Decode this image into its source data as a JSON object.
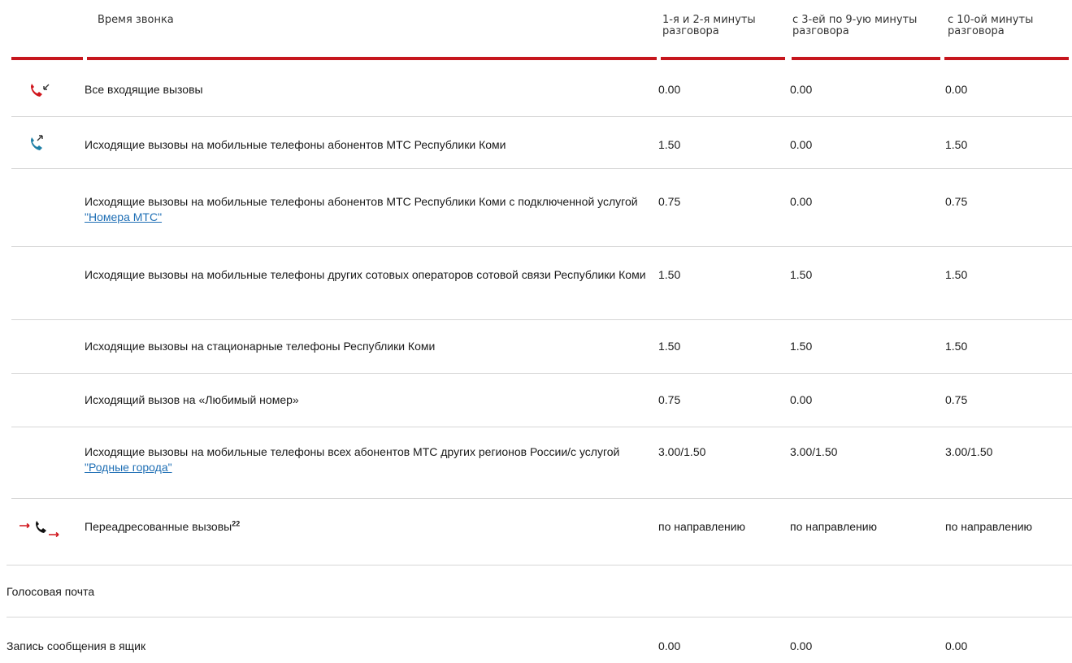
{
  "header": {
    "col_name": "Время звонка",
    "col_v1": "1-я и 2-я минуты разговора",
    "col_v2": "с 3-ей по 9-ую минуты разговора",
    "col_v3": "с 10-ой минуты разговора"
  },
  "rows": [
    {
      "icon": "incoming-call-icon",
      "label": "Все входящие вызовы",
      "v1": "0.00",
      "v2": "0.00",
      "v3": "0.00"
    },
    {
      "icon": "outgoing-call-icon",
      "label": "Исходящие вызовы на мобильные телефоны абонентов МТС Республики Коми",
      "v1": "1.50",
      "v2": "0.00",
      "v3": "1.50"
    },
    {
      "label_pre": "Исходящие вызовы на мобильные телефоны абонентов МТС Республики Коми с подключенной услугой ",
      "link": "\"Номера МТС\"",
      "v1": "0.75",
      "v2": "0.00",
      "v3": "0.75"
    },
    {
      "label": "Исходящие вызовы на мобильные телефоны других сотовых операторов сотовой связи Республики Коми",
      "v1": "1.50",
      "v2": "1.50",
      "v3": "1.50"
    },
    {
      "label": "Исходящие вызовы на стационарные телефоны Республики Коми",
      "v1": "1.50",
      "v2": "1.50",
      "v3": "1.50"
    },
    {
      "label": "Исходящий вызов на «Любимый номер»",
      "v1": "0.75",
      "v2": "0.00",
      "v3": "0.75"
    },
    {
      "label_pre": "Исходящие вызовы на мобильные телефоны всех абонентов МТС других регионов России/с услугой ",
      "link": "\"Родные города\"",
      "v1": "3.00/1.50",
      "v2": "3.00/1.50",
      "v3": "3.00/1.50"
    },
    {
      "icon": "forwarded-call-icon",
      "label": "Переадресованные вызовы",
      "footnote": "22",
      "v1": "по направлению",
      "v2": "по направлению",
      "v3": "по направлению"
    }
  ],
  "voicemail": {
    "section_title": "Голосовая почта",
    "record_label": "Запись сообщения в ящик",
    "v1": "0.00",
    "v2": "0.00",
    "v3": "0.00"
  },
  "colors": {
    "accent_red": "#c6161d",
    "link_blue": "#1f6fb5",
    "icon_teal": "#1f7fa6",
    "separator": "#d6d6d6"
  }
}
